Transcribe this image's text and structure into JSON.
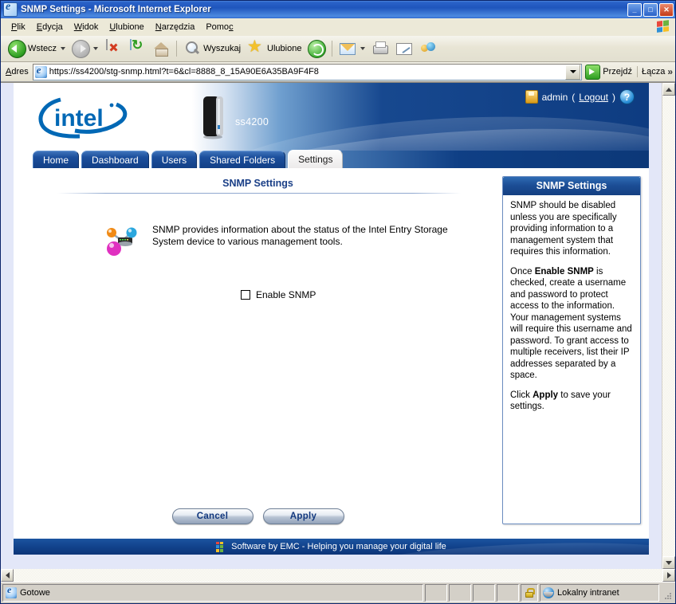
{
  "window": {
    "title": "SNMP Settings - Microsoft Internet Explorer",
    "icon": "ie-document-icon",
    "minimize": "_",
    "maximize": "□",
    "close": "✕"
  },
  "menubar": {
    "items": [
      {
        "label": "Plik",
        "accel": "P"
      },
      {
        "label": "Edycja",
        "accel": "E"
      },
      {
        "label": "Widok",
        "accel": "W"
      },
      {
        "label": "Ulubione",
        "accel": "U"
      },
      {
        "label": "Narzędzia",
        "accel": "N"
      },
      {
        "label": "Pomoc",
        "accel": "c"
      }
    ]
  },
  "toolbar": {
    "back_label": "Wstecz",
    "search_label": "Wyszukaj",
    "favorites_label": "Ulubione",
    "icons": [
      "back-icon",
      "forward-icon",
      "stop-icon",
      "refresh-icon",
      "home-icon",
      "search-icon",
      "favorites-star-icon",
      "history-icon",
      "mail-icon",
      "print-icon",
      "edit-icon",
      "messenger-icon"
    ]
  },
  "address_bar": {
    "label": "Adres",
    "url": "https://ss4200/stg-snmp.html?t=6&cl=8888_8_15A90E6A35BA9F4F8",
    "go_label": "Przejdź",
    "links_label": "Łącza",
    "links_chevron": "»"
  },
  "app": {
    "brand": "intel",
    "device_name": "ss4200",
    "user": {
      "name": "admin",
      "logout_prefix": "(",
      "logout_label": "Logout",
      "logout_suffix": ")",
      "help_glyph": "?"
    },
    "tabs": [
      {
        "label": "Home",
        "active": false
      },
      {
        "label": "Dashboard",
        "active": false
      },
      {
        "label": "Users",
        "active": false
      },
      {
        "label": "Shared Folders",
        "active": false
      },
      {
        "label": "Settings",
        "active": true
      }
    ],
    "main": {
      "page_title": "SNMP Settings",
      "description": "SNMP provides information about the status of the Intel Entry Storage System device to various management tools.",
      "checkbox_label": "Enable SNMP",
      "checkbox_checked": false,
      "cancel_label": "Cancel",
      "apply_label": "Apply"
    },
    "help_panel": {
      "title": "SNMP Settings",
      "paragraph_1": "SNMP should be disabled unless you are specifically providing information to a management system that requires this information.",
      "paragraph_2_part1": "Once ",
      "paragraph_2_bold": "Enable SNMP",
      "paragraph_2_part2": " is checked, create a username and password to protect access to the information. Your management systems will require this username and password. To grant access to multiple receivers, list their IP addresses separated by a space.",
      "paragraph_3_part1": "Click ",
      "paragraph_3_bold": "Apply",
      "paragraph_3_part2": " to save your settings."
    },
    "footer": {
      "text": "Software by EMC - Helping you manage your digital life",
      "logo": "emc-logo"
    }
  },
  "statusbar": {
    "status": "Gotowe",
    "zone": "Lokalny intranet",
    "lock": "secure-lock-icon"
  },
  "colors": {
    "accent_blue": "#12387e",
    "banner_blue": "#0e3c81",
    "title_blue": "#1f55bd",
    "page_bg": "#e3e7f8",
    "help_border": "#6b8cc0"
  }
}
